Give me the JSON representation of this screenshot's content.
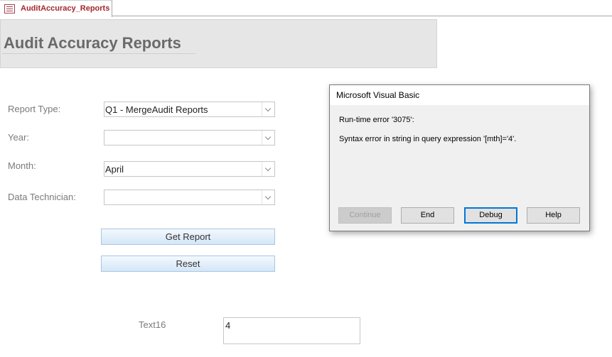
{
  "tab": {
    "label": "AuditAccuracy_Reports"
  },
  "header": {
    "title": "Audit Accuracy Reports"
  },
  "form": {
    "report_type": {
      "label": "Report Type:",
      "value": "Q1 - MergeAudit Reports"
    },
    "year": {
      "label": "Year:",
      "value": ""
    },
    "month": {
      "label": "Month:",
      "value": "April"
    },
    "data_technician": {
      "label": "Data Technician:",
      "value": ""
    },
    "get_report_label": "Get Report",
    "reset_label": "Reset",
    "text16": {
      "label": "Text16",
      "value": "4"
    }
  },
  "dialog": {
    "title": "Microsoft Visual Basic",
    "error_line": "Run-time error '3075':",
    "message": "Syntax error in string in query expression '[mth]='4'.",
    "buttons": {
      "continue": "Continue",
      "end": "End",
      "debug": "Debug",
      "help": "Help"
    }
  }
}
